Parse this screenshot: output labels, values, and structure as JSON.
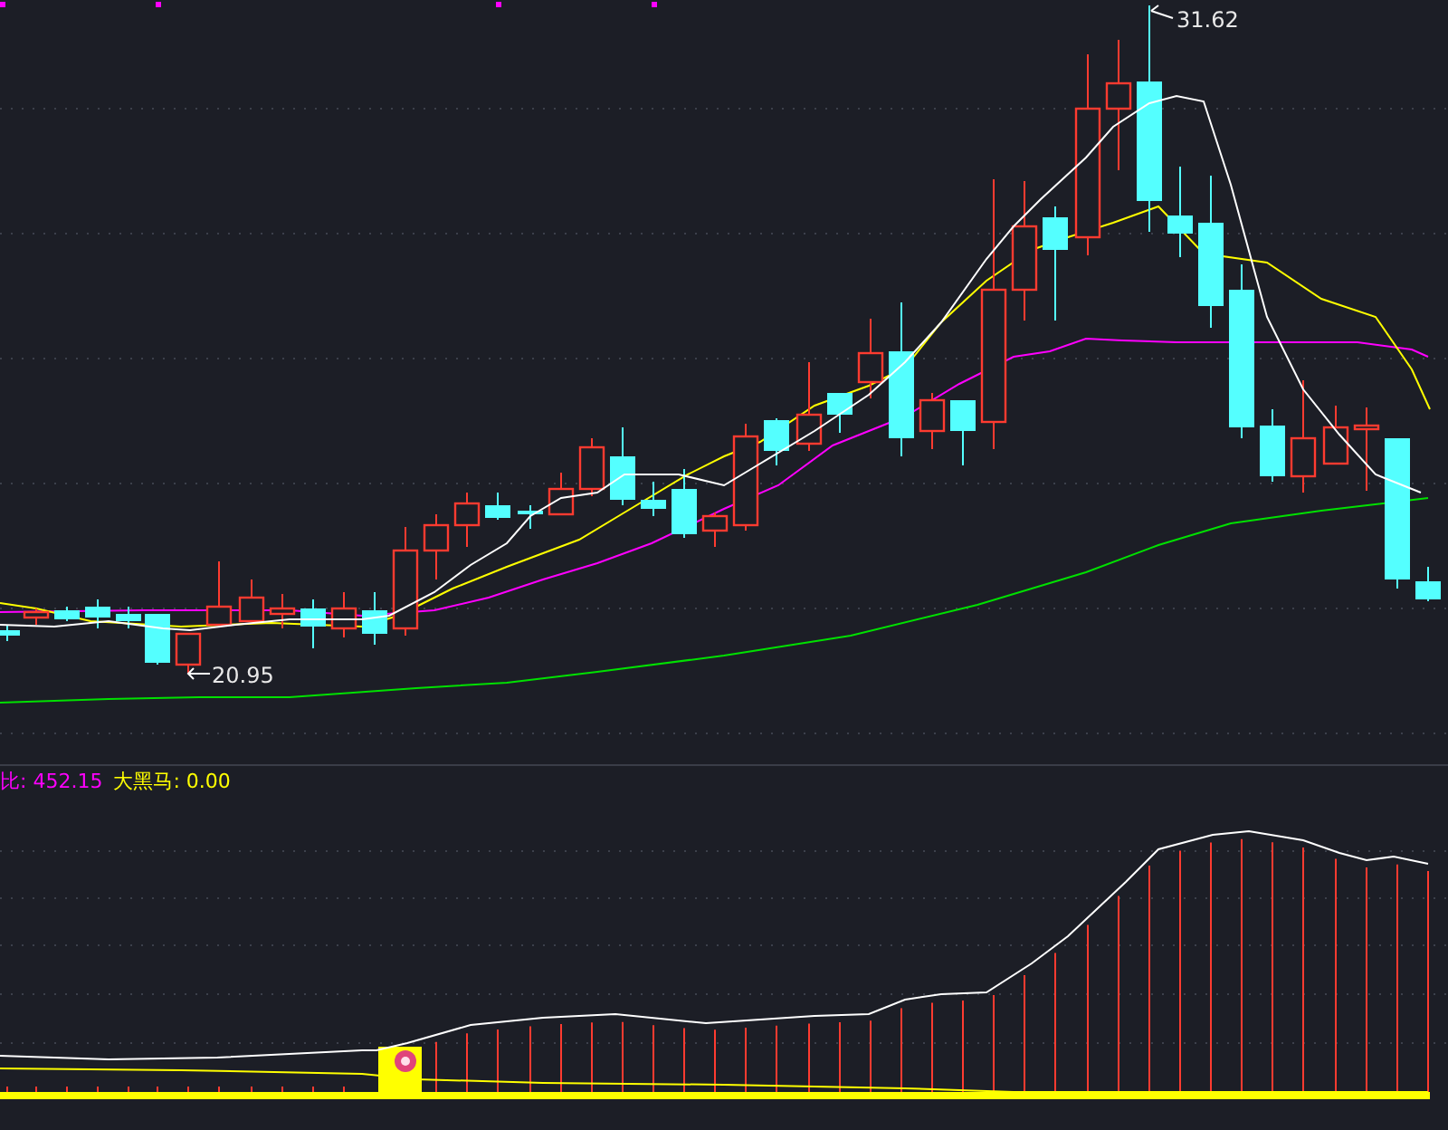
{
  "main_chart": {
    "high_label": "31.62",
    "low_label": "20.95"
  },
  "indicator": {
    "legend": [
      {
        "text": "比: 452.15",
        "color": "#ff00ff"
      },
      {
        "text": "大黑马: 0.00",
        "color": "#ffff00"
      }
    ]
  }
}
